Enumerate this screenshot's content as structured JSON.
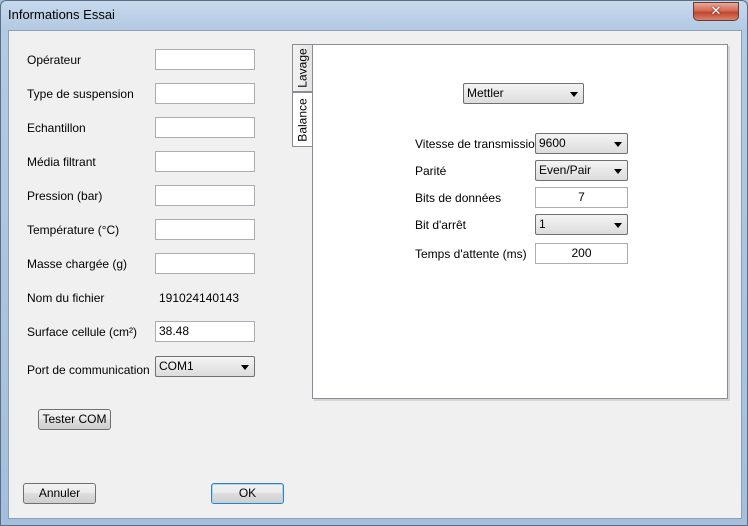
{
  "window": {
    "title": "Informations Essai",
    "close_glyph": "✕"
  },
  "form": {
    "operateur_label": "Opérateur",
    "operateur_value": "",
    "suspension_label": "Type de suspension",
    "suspension_value": "",
    "echantillon_label": "Echantillon",
    "echantillon_value": "",
    "media_label": "Média filtrant",
    "media_value": "",
    "pression_label": "Pression (bar)",
    "pression_value": "",
    "temperature_label": "Température (°C)",
    "temperature_value": "",
    "masse_label": "Masse chargée (g)",
    "masse_value": "",
    "fichier_label": "Nom du fichier",
    "fichier_value": "191024140143",
    "surface_label": "Surface cellule (cm²)",
    "surface_value": "38.48",
    "port_label": "Port de communication",
    "port_value": "COM1",
    "tester_label": "Tester COM",
    "annuler_label": "Annuler",
    "ok_label": "OK"
  },
  "tabs": [
    {
      "label": "Lavage",
      "active": false
    },
    {
      "label": "Balance",
      "active": true
    }
  ],
  "balance": {
    "model_value": "Mettler",
    "vitesse_label": "Vitesse de transmission",
    "vitesse_value": "9600",
    "parite_label": "Parité",
    "parite_value": "Even/Pair",
    "bits_label": "Bits de données",
    "bits_value": "7",
    "arret_label": "Bit d'arrêt",
    "arret_value": "1",
    "attente_label": "Temps d'attente (ms)",
    "attente_value": "200"
  }
}
